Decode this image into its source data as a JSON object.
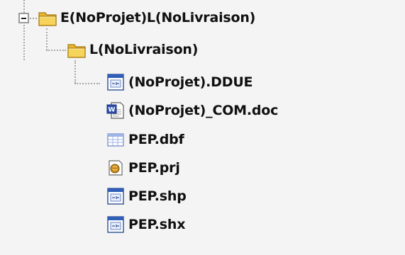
{
  "tree": {
    "root": {
      "label": "E(NoProjet)L(NoLivraison)",
      "icon": "folder-icon",
      "expanded": true
    },
    "child": {
      "label": "L(NoLivraison)",
      "icon": "folder-icon"
    },
    "files": [
      {
        "label": "(NoProjet).DDUE",
        "icon": "executable-window-icon"
      },
      {
        "label": "(NoProjet)_COM.doc",
        "icon": "word-document-icon"
      },
      {
        "label": "PEP.dbf",
        "icon": "database-table-icon"
      },
      {
        "label": "PEP.prj",
        "icon": "projection-file-icon"
      },
      {
        "label": "PEP.shp",
        "icon": "executable-window-icon"
      },
      {
        "label": "PEP.shx",
        "icon": "executable-window-icon"
      }
    ]
  },
  "colors": {
    "background": "#f4f4f4",
    "folder": "#f2c84b",
    "connector": "#a8a8a8",
    "text": "#101010"
  }
}
